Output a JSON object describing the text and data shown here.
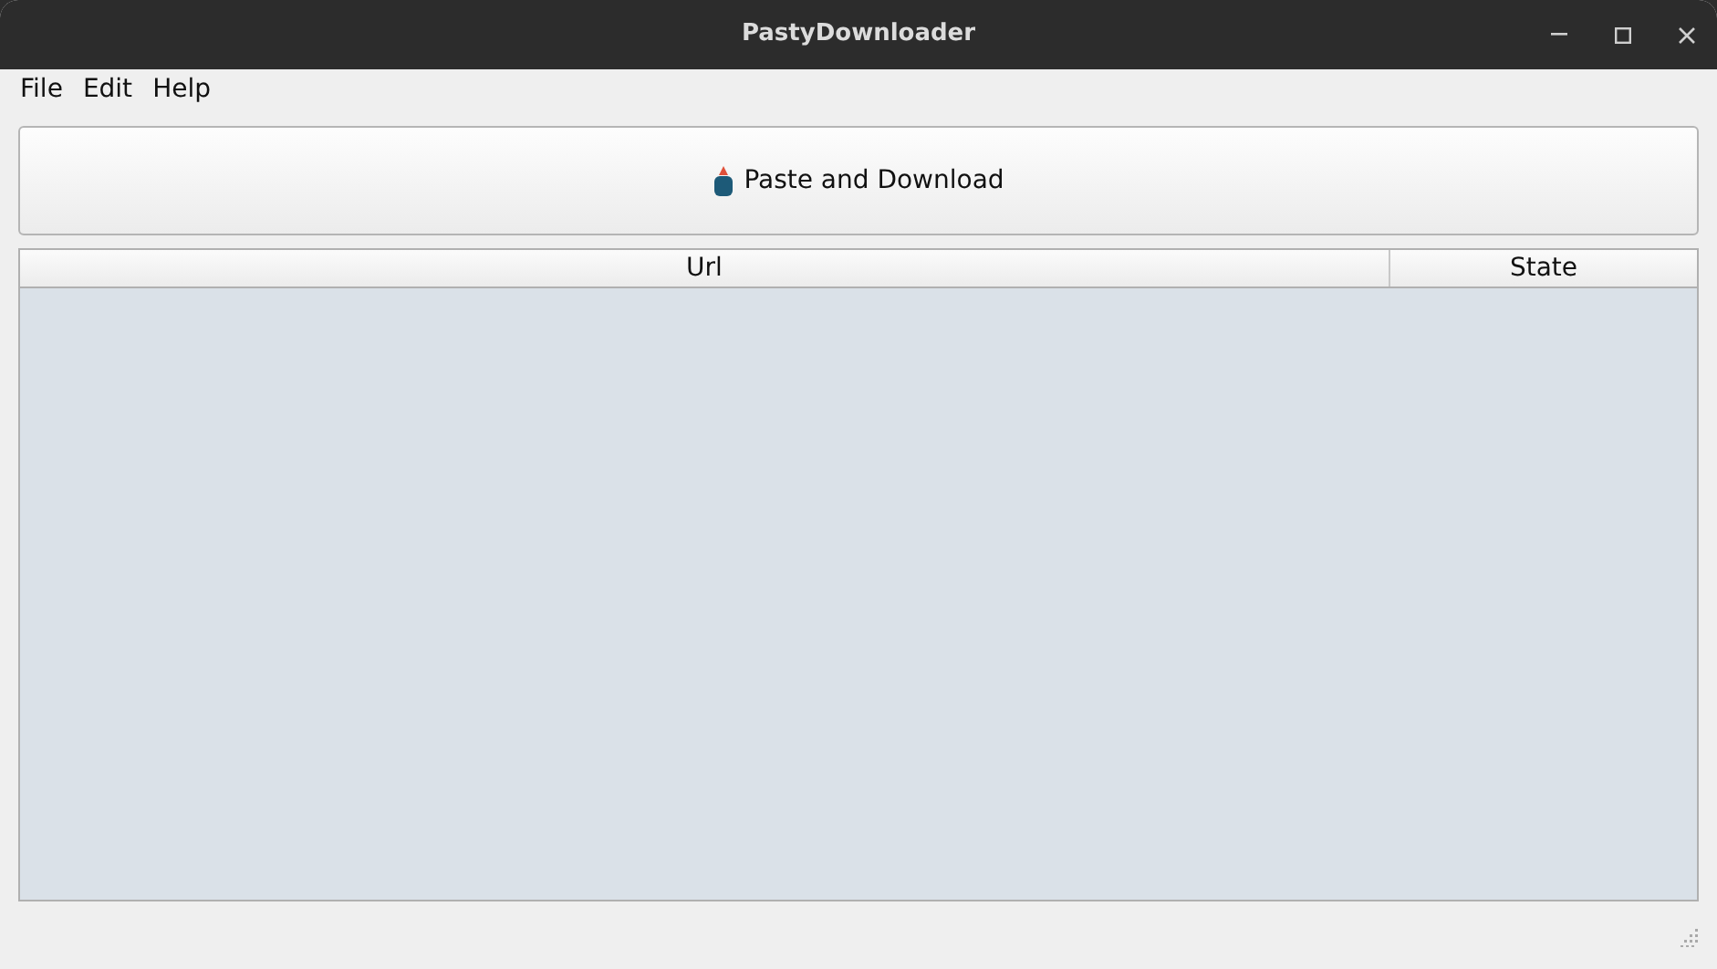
{
  "window": {
    "title": "PastyDownloader"
  },
  "menu": [
    "File",
    "Edit",
    "Help"
  ],
  "button": {
    "label": "Paste and Download"
  },
  "table": {
    "columns": [
      "Url",
      "State"
    ]
  }
}
